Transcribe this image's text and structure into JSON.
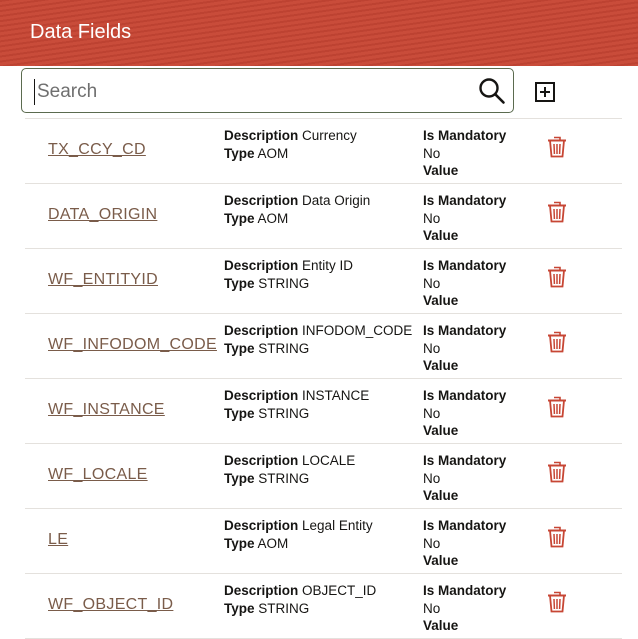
{
  "header": {
    "title": "Data Fields"
  },
  "search": {
    "placeholder": "Search",
    "value": ""
  },
  "labels": {
    "description": "Description",
    "type": "Type",
    "is_mandatory": "Is Mandatory",
    "value": "Value"
  },
  "fields": [
    {
      "name": "TX_CCY_CD",
      "description": "Currency",
      "type": "AOM",
      "mandatory": "No",
      "value": ""
    },
    {
      "name": "DATA_ORIGIN",
      "description": "Data Origin",
      "type": "AOM",
      "mandatory": "No",
      "value": ""
    },
    {
      "name": "WF_ENTITYID",
      "description": "Entity ID",
      "type": "STRING",
      "mandatory": "No",
      "value": ""
    },
    {
      "name": "WF_INFODOM_CODE",
      "description": "INFODOM_CODE",
      "type": "STRING",
      "mandatory": "No",
      "value": ""
    },
    {
      "name": "WF_INSTANCE",
      "description": "INSTANCE",
      "type": "STRING",
      "mandatory": "No",
      "value": ""
    },
    {
      "name": "WF_LOCALE",
      "description": "LOCALE",
      "type": "STRING",
      "mandatory": "No",
      "value": ""
    },
    {
      "name": "LE",
      "description": "Legal Entity",
      "type": "AOM",
      "mandatory": "No",
      "value": ""
    },
    {
      "name": "WF_OBJECT_ID",
      "description": "OBJECT_ID",
      "type": "STRING",
      "mandatory": "No",
      "value": ""
    }
  ],
  "colors": {
    "header_bg": "#c74634",
    "link": "#7a5c4a",
    "delete_icon": "#c74634"
  }
}
